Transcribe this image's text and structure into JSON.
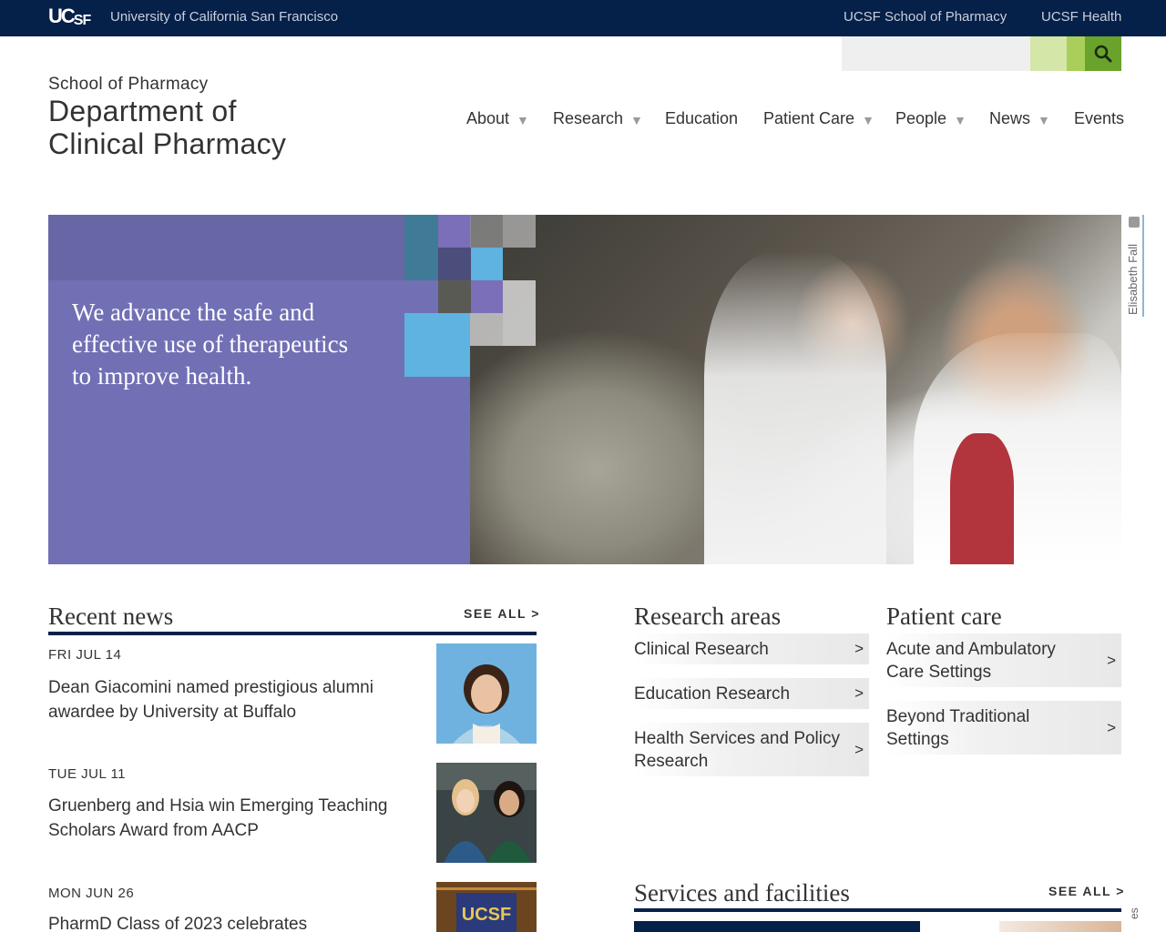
{
  "topbar": {
    "logo_uc": "UC",
    "logo_sf": "SF",
    "university": "University of California San Francisco",
    "links": [
      "UCSF School of Pharmacy",
      "UCSF Health"
    ]
  },
  "search": {
    "placeholder": "",
    "value": ""
  },
  "site": {
    "school": "School of Pharmacy",
    "dept_line1": "Department of",
    "dept_line2": "Clinical Pharmacy"
  },
  "nav": {
    "items": [
      {
        "label": "About",
        "dropdown": true
      },
      {
        "label": "Research",
        "dropdown": true
      },
      {
        "label": "Education",
        "dropdown": false
      },
      {
        "label": "Patient Care",
        "dropdown": true
      },
      {
        "label": "People",
        "dropdown": true
      },
      {
        "label": "News",
        "dropdown": true
      },
      {
        "label": "Events",
        "dropdown": false
      }
    ],
    "caret": "▼"
  },
  "hero": {
    "tagline": "We advance the safe and effective use of therapeutics to improve health.",
    "photo_credit": "Elisabeth Fall"
  },
  "news": {
    "title": "Recent news",
    "see_all": "SEE ALL >",
    "items": [
      {
        "date": "FRI JUL 14",
        "title": "Dean Giacomini named prestigious alumni awardee by University at Buffalo"
      },
      {
        "date": "TUE JUL 11",
        "title": "Gruenberg and Hsia win Emerging Teaching Scholars Award from AACP"
      },
      {
        "date": "MON JUN 26",
        "title": "PharmD Class of 2023 celebrates"
      }
    ]
  },
  "research_areas": {
    "title": "Research areas",
    "items": [
      {
        "label": "Clinical Research"
      },
      {
        "label": "Education Research"
      },
      {
        "label": "Health Services and Policy Research"
      }
    ]
  },
  "patient_care": {
    "title": "Patient care",
    "items": [
      {
        "label": "Acute and Ambulatory Care Settings"
      },
      {
        "label": "Beyond Traditional Settings"
      }
    ]
  },
  "services": {
    "title": "Services and facilities",
    "see_all": "SEE ALL >"
  },
  "arrow": ">",
  "side_fragment": "es",
  "colors": {
    "navy": "#052049",
    "hero_purple": "#7170b4",
    "search_green": "#6aa32c"
  }
}
